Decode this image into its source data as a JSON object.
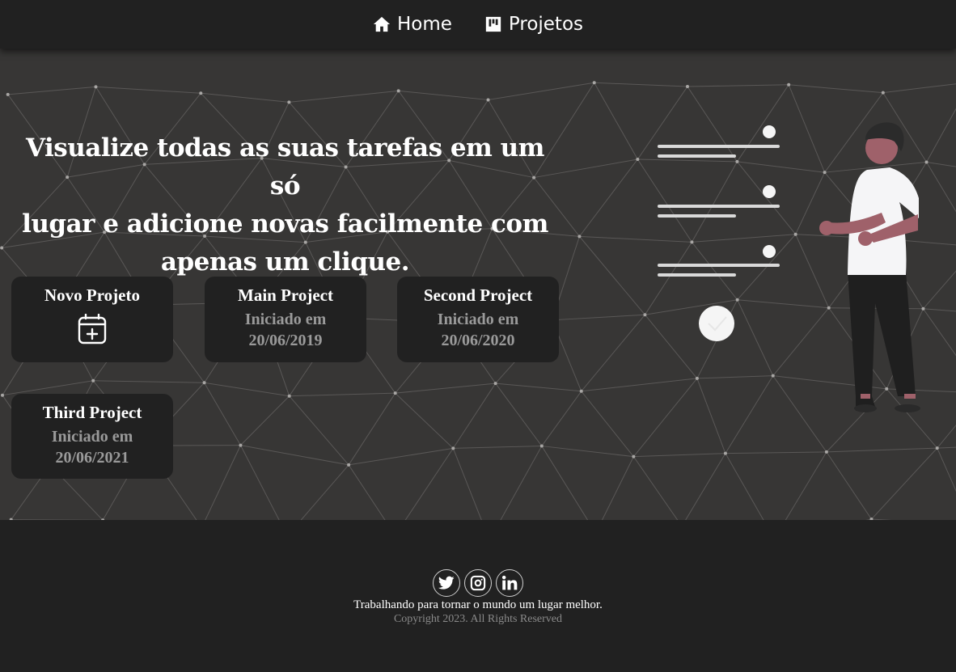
{
  "nav": {
    "items": [
      {
        "label": "Home",
        "icon": "home-icon"
      },
      {
        "label": "Projetos",
        "icon": "board-icon"
      }
    ]
  },
  "hero": {
    "headline_lines": [
      "Visualize todas as suas tarefas em um só",
      "lugar e adicione novas facilmente com",
      "apenas um clique."
    ],
    "new_project": {
      "title": "Novo Projeto",
      "icon": "calendar-plus-icon"
    },
    "projects": [
      {
        "title": "Main Project",
        "started_label": "Iniciado em",
        "date": "20/06/2019"
      },
      {
        "title": "Second Project",
        "started_label": "Iniciado em",
        "date": "20/06/2020"
      },
      {
        "title": "Third Project",
        "started_label": "Iniciado em",
        "date": "20/06/2021"
      }
    ]
  },
  "footer": {
    "socials": [
      "twitter-icon",
      "instagram-icon",
      "linkedin-icon"
    ],
    "tagline": "Trabalhando para tornar o mundo um lugar melhor.",
    "copyright": "Copyright 2023. All Rights Reserved"
  },
  "colors": {
    "nav_bg": "#212121",
    "hero_bg": "#373635",
    "card_bg": "#212121",
    "muted_text": "#9a9a9a",
    "accent_skin": "#9f616a"
  }
}
